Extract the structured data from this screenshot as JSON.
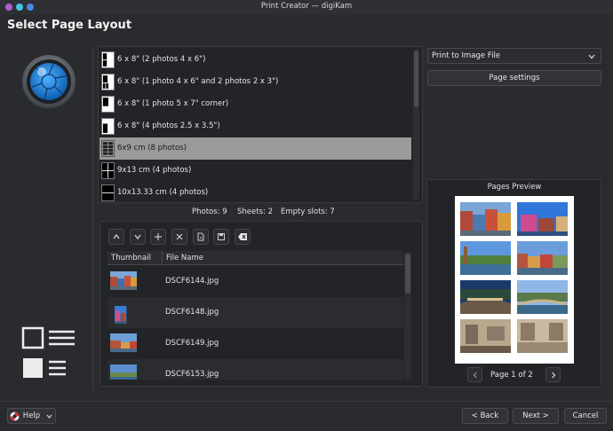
{
  "window": {
    "title": "Print Creator — digiKam"
  },
  "page_title": "Select Page Layout",
  "layouts": [
    {
      "label": "6 x 8\" (2 photos 4 x 6\")",
      "selected": false
    },
    {
      "label": "6 x 8\" (1 photo 4 x 6\" and 2 photos 2 x 3\")",
      "selected": false
    },
    {
      "label": "6 x 8\" (1 photo 5 x 7\" corner)",
      "selected": false
    },
    {
      "label": "6 x 8\" (4 photos 2.5 x 3.5\")",
      "selected": false
    },
    {
      "label": "6x9 cm (8 photos)",
      "selected": true
    },
    {
      "label": "9x13 cm (4 photos)",
      "selected": false
    },
    {
      "label": "10x13.33 cm (4 photos)",
      "selected": false
    }
  ],
  "stats": {
    "photos": "Photos:  9",
    "sheets": "Sheets:  2",
    "empty": "Empty slots:  7"
  },
  "photo_table": {
    "col_thumbnail": "Thumbnail",
    "col_filename": "File Name",
    "rows": [
      "DSCF6144.jpg",
      "DSCF6148.jpg",
      "DSCF6149.jpg",
      "DSCF6153.jpg"
    ]
  },
  "printer": {
    "selected": "Print to Image File"
  },
  "page_settings_label": "Page settings",
  "preview": {
    "title": "Pages Preview",
    "page_label": "Page 1 of 2"
  },
  "footer": {
    "help": "Help",
    "back": "< Back",
    "next": "Next >",
    "cancel": "Cancel"
  },
  "colors": {
    "accent_blue": "#1e88e5",
    "selected_row": "#9a9a9a",
    "background": "#2a2b2e"
  }
}
